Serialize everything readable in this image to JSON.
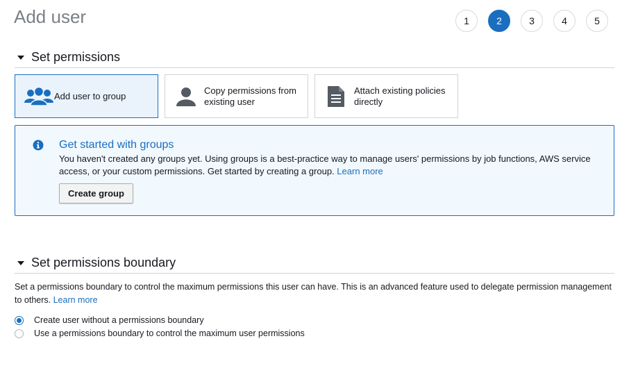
{
  "page": {
    "title": "Add user"
  },
  "steps": [
    {
      "label": "1",
      "active": false
    },
    {
      "label": "2",
      "active": true
    },
    {
      "label": "3",
      "active": false
    },
    {
      "label": "4",
      "active": false
    },
    {
      "label": "5",
      "active": false
    }
  ],
  "permissions": {
    "section_title": "Set permissions",
    "options": [
      {
        "label": "Add user to group",
        "icon": "users-group-icon",
        "selected": true
      },
      {
        "label": "Copy permissions from existing user",
        "icon": "user-icon",
        "selected": false
      },
      {
        "label": "Attach existing policies directly",
        "icon": "document-icon",
        "selected": false
      }
    ],
    "info": {
      "icon": "info-icon",
      "title": "Get started with groups",
      "body": "You haven't created any groups yet. Using groups is a best-practice way to manage users' permissions by job functions, AWS service access, or your custom permissions. Get started by creating a group.",
      "link": "Learn more",
      "button": "Create group"
    }
  },
  "boundary": {
    "section_title": "Set permissions boundary",
    "description": "Set a permissions boundary to control the maximum permissions this user can have. This is an advanced feature used to delegate permission management to others.",
    "link": "Learn more",
    "radios": [
      {
        "label": "Create user without a permissions boundary",
        "checked": true
      },
      {
        "label": "Use a permissions boundary to control the maximum user permissions",
        "checked": false
      }
    ]
  },
  "colors": {
    "accent": "#1a6ebf",
    "info_bg": "#f1f8fe",
    "selected_bg": "#eaf3fc",
    "icon_gray": "#545b64"
  }
}
